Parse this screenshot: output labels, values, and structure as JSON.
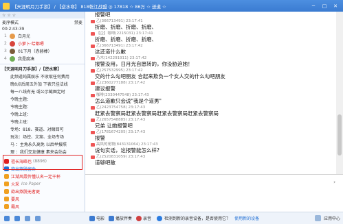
{
  "window": {
    "title": "【天涯明月刀手游】 / 【逆水寒】 818乾江战盟 ◎ 17818 ☆ 86万 ☆ 送道 ☆"
  },
  "left_panel": {
    "topbar": [
      "☆",
      "☆",
      "☆"
    ],
    "mode_label": "麦序模式",
    "mode_time": "00:2∶43:39",
    "mode_action": "禁麦",
    "ranks": [
      {
        "no": "1",
        "name": "白月光"
      },
      {
        "no": "2",
        "name": "小萝卜·给都嗯"
      },
      {
        "no": "3",
        "name": "01下月（赤赫棒）"
      },
      {
        "no": "4",
        "name": "我是度凑"
      }
    ],
    "notice": [
      "【天涯明月刀手游】/【逆水寒】",
      "此频道纯属娱乐 不收取任何费用",
      "晚8点后周五外加 下表只挂法线",
      "每一八线有无 或公示截图定时",
      "今晚主题：",
      "今晚主题：",
      "今晚上班：",
      "今晚上班：",
      "专场：818、赛道、对赌回可",
      "玩法：场控、文案、全场专场",
      "马 ：主角永久高免 以后举报照",
      "理 ：我们交友健康 素来会站会"
    ],
    "users": [
      {
        "name": "祖长海晤也",
        "tag": "(8896)",
        "style": "red"
      },
      {
        "name": "欲出煞脱留命",
        "tag": "",
        "style": "blue"
      },
      {
        "name": "江湖风霞传懂认名一定干杯",
        "tag": "",
        "style": "red"
      },
      {
        "name": "火采",
        "tag": "Ice Paper",
        "style": "gray"
      },
      {
        "name": "欲出煞脱无者更",
        "tag": "",
        "style": "red"
      },
      {
        "name": "要风",
        "tag": "",
        "style": "red"
      },
      {
        "name": "霸风",
        "tag": "",
        "style": "red"
      }
    ]
  },
  "chat": {
    "messages": [
      {
        "meta": "",
        "text": "报警吧"
      },
      {
        "meta": "乙(366713491) 23:17:41",
        "text": "折磨、折磨、折磨、折磨、"
      },
      {
        "meta": "【企】咖啡(2215031) 23:17:41",
        "text": "折磨、折磨、折磨、折磨、"
      },
      {
        "meta": "乙(366713491) 23:17:42",
        "text": "这还道什么歉"
      },
      {
        "meta": "乃木(142291911) 23:17:42",
        "text": "报警没用，日月光自愿转的，你没胁迫她！"
      },
      {
        "meta": "乙(257532995) 23:17:42",
        "text": "交的什么勾吧朋友 合起来欺负一个女人交的什么勾吧朋友"
      },
      {
        "meta": "乙(2360277188) 23:17:42",
        "text": "建议报警"
      },
      {
        "meta": "咖啡(2330447548) 23:17:43",
        "text": "怎么道歉只会说\"我是个道男\""
      },
      {
        "meta": "乙(2423754758) 23:17:43",
        "text": "赶紧去警察局赶紧去警察局赶紧去警察局赶紧去警察局"
      },
      {
        "meta": "乙(2657548885) 23:17:43",
        "text": "兄弟 让她报警吧"
      },
      {
        "meta": "乙(1781674205) 23:17:43",
        "text": "报警"
      },
      {
        "meta": "高风的宠物(843131064) 23:17:43",
        "text": "说句实话，这报警能怎么样?"
      },
      {
        "meta": "乙(2520831059) 23:17:43",
        "text": "道够吧敞"
      }
    ]
  },
  "bottombar": {
    "icons": [
      "mic-icon",
      "speaker-icon",
      "hand-icon",
      "music-icon"
    ],
    "items": [
      "电影",
      "播放伴奏",
      "录音"
    ],
    "tip": "检测到新的录音设备，是否使用它？",
    "link": "使用新的设备",
    "right": [
      "应用中心"
    ]
  },
  "colors": {
    "title_bg": "#3a7bd1",
    "highlight_border": "#e02020",
    "link": "#1f6ed4"
  }
}
